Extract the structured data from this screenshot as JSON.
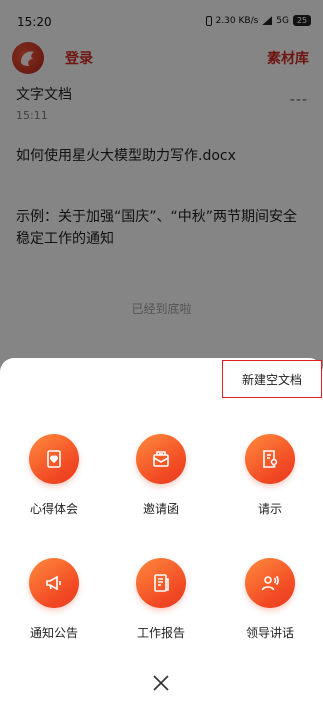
{
  "status_bar": {
    "time": "15:20",
    "speed": "2.30 KB/s",
    "network": "5G",
    "battery": "25"
  },
  "app_bar": {
    "login_label": "登录",
    "material_label": "素材库"
  },
  "documents": [
    {
      "title": "文字文档",
      "time": "15:11",
      "more": "---"
    },
    {
      "title": "如何使用星火大模型助力写作.docx"
    },
    {
      "title": "示例：关于加强“国庆”、“中秋”两节期间安全稳定工作的通知"
    }
  ],
  "bottom_note": "已经到底啦",
  "sheet": {
    "new_blank_label": "新建空文档",
    "options": [
      {
        "label": "心得体会",
        "icon": "heart-document-icon"
      },
      {
        "label": "邀请函",
        "icon": "invitation-envelope-icon"
      },
      {
        "label": "请示",
        "icon": "request-document-icon"
      },
      {
        "label": "通知公告",
        "icon": "megaphone-icon"
      },
      {
        "label": "工作报告",
        "icon": "report-document-icon"
      },
      {
        "label": "领导讲话",
        "icon": "speaker-person-icon"
      }
    ]
  },
  "colors": {
    "accent": "#c8291f",
    "icon_gradient_start": "#ff8a3d",
    "icon_gradient_end": "#e83a1f",
    "highlight_border": "#e02020"
  }
}
